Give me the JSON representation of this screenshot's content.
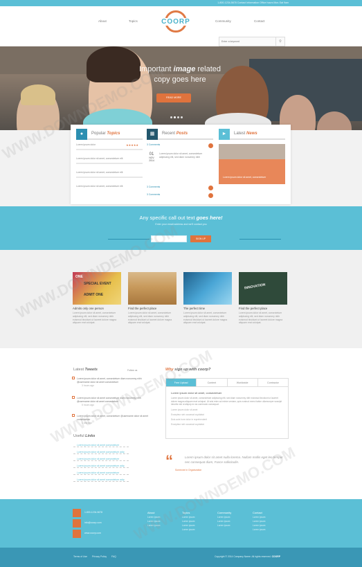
{
  "topbar": {
    "info": "1-800-1234-5678  Contact Information Office hours Mon-Sat 9am"
  },
  "nav": {
    "about": "About",
    "topics": "Topics",
    "community": "Community",
    "contact": "Contact"
  },
  "logo": {
    "text": "COORP"
  },
  "search": {
    "placeholder": "Enter a keyword"
  },
  "hero": {
    "line1": "Important",
    "line1b": "image",
    "line1c": "related",
    "line2": "copy goes here",
    "button": "READ MORE"
  },
  "panels": {
    "popular": {
      "title_a": "Popular",
      "title_b": "Topics",
      "items": [
        "Lorem ipsum dolor",
        "Lorem ipsum dolor sit amet, consectetuer elit",
        "Lorem ipsum dolor sit amet, consectetuer elit",
        "Lorem ipsum dolor sit amet, consectetuer elit"
      ]
    },
    "recent": {
      "title_a": "Recent",
      "title_b": "Posts",
      "date_day": "01",
      "date_month": "NOV",
      "date_year": "2014",
      "text": "Lorem ipsum dolor sit amet, consectetuer adipiscing elit, sed diam nonummy nibh",
      "comments": "3 Comments"
    },
    "news": {
      "title_a": "Latest",
      "title_b": "News",
      "caption": "Lorem ipsum dolor sit amet, consectetuer"
    }
  },
  "cta": {
    "title_a": "Any specific call out text",
    "title_b": "goes here!",
    "sub": "Enter your email address and we'll contact you",
    "button": "SIGN UP"
  },
  "features": [
    {
      "title": "Admits only one person",
      "body": "Lorem ipsum dolor sit amet, consectetuer adipiscing elit, sed diam nonummy nibh euismod tincidunt ut laoreet dolore magna aliquam erat volutpat."
    },
    {
      "title": "Find the perfect place",
      "body": "Lorem ipsum dolor sit amet, consectetuer adipiscing elit, sed diam nonummy nibh euismod tincidunt ut laoreet dolore magna aliquam erat volutpat."
    },
    {
      "title": "The perfect time",
      "body": "Lorem ipsum dolor sit amet, consectetuer adipiscing elit, sed diam nonummy nibh euismod tincidunt ut laoreet dolore magna aliquam erat volutpat."
    },
    {
      "title": "Find the perfect place",
      "body": "Lorem ipsum dolor sit amet, consectetuer adipiscing elit, sed diam nonummy nibh euismod tincidunt ut laoreet dolore magna aliquam erat volutpat."
    }
  ],
  "feature_badges": {
    "one": "ONE",
    "special": "SPECIAL EVENT",
    "admit": "ADMIT ONE",
    "innovation": "INNOVATION"
  },
  "tweets": {
    "title_a": "Latest",
    "title_b": "Tweets",
    "follow": "Follow us",
    "items": [
      {
        "text": "Lorem ipsum dolor sit amet, consectetuer diam nonummy nibh @username dolor sit amet consectetuer",
        "ago": "3 hours ago"
      },
      {
        "text": "Lorem ipsum dolor sit amet consectetuer diam nonummy nibh @username dolor sit amet consectetuer",
        "ago": "5 hours ago"
      },
      {
        "text": "Lorem ipsum dolor sit amet, consectetuer @username dolor sit amet consectetuer",
        "ago": "1 day ago"
      }
    ]
  },
  "useful": {
    "title_a": "Useful",
    "title_b": "Links",
    "items": [
      "Lorem ipsum dolor sit amet consectetuer",
      "Lorem ipsum dolor sit amet consectetuer adip",
      "Lorem ipsum dolor sit amet consectetuer",
      "Lorem ipsum dolor sit amet consectetuer adip",
      "Lorem ipsum dolor sit amet consectetuer",
      "Lorem ipsum dolor sit amet consectetuer adip"
    ]
  },
  "why": {
    "title_a": "Why",
    "title_b": "sign up with coorp?",
    "tabs": [
      "Free Upload",
      "Content",
      "Worldwide",
      "Contractor"
    ],
    "heading": "Lorem ipsum dolor sit amet, consectetuer",
    "para": "Lorem ipsum dolor sit amet, consectetuer adipiscing elit, sed diam nonummy nibh euismod tincidunt ut laoreet dolore magna aliquam erat volutpat. Ut wisi enim ad minim veniam, quis nostrud exerci tation ullamcorper suscipit lobortis nisl ut aliquip ex ea commodo consequat.",
    "list": [
      "Lorem ipsum dolor sit amet",
      "Excepteur sint occaecat cupidatat",
      "Duis aute irure dolor in reprehenderit",
      "Excepteur sint occaecat cupidatat"
    ]
  },
  "quote": {
    "text": "Lorem ipsum dolor sit amet nulla lorema. Nullam mollis eget leo tempor nec consequat diam, Fusce sollicitudin.",
    "by": "Someone in Organization"
  },
  "footer": {
    "phone": "1-800-1234-5678",
    "email": "info@coorp.com",
    "web": "www.coorp.com",
    "cols": [
      {
        "head": "About",
        "items": [
          "Lorem ipsum",
          "Lorem ipsum",
          "Lorem ipsum"
        ]
      },
      {
        "head": "Topics",
        "items": [
          "Lorem ipsum",
          "Lorem ipsum",
          "Lorem ipsum",
          "Lorem ipsum"
        ]
      },
      {
        "head": "Community",
        "items": [
          "Lorem ipsum",
          "Lorem ipsum",
          "Lorem ipsum"
        ]
      },
      {
        "head": "Contact",
        "items": [
          "Lorem ipsum",
          "Lorem ipsum",
          "Lorem ipsum",
          "Lorem ipsum"
        ]
      }
    ]
  },
  "bottom": {
    "links": [
      "Terms of Use",
      "Privacy Policy",
      "FAQ"
    ],
    "copy": "Copyright © 2014 Company Name. All rights reserved.",
    "brand": "COORP"
  },
  "watermark": "WWW.DOWNDEMO.COM",
  "colors": {
    "accent": "#e0733d",
    "primary": "#5bbfd6",
    "dark": "#3a97b5"
  }
}
